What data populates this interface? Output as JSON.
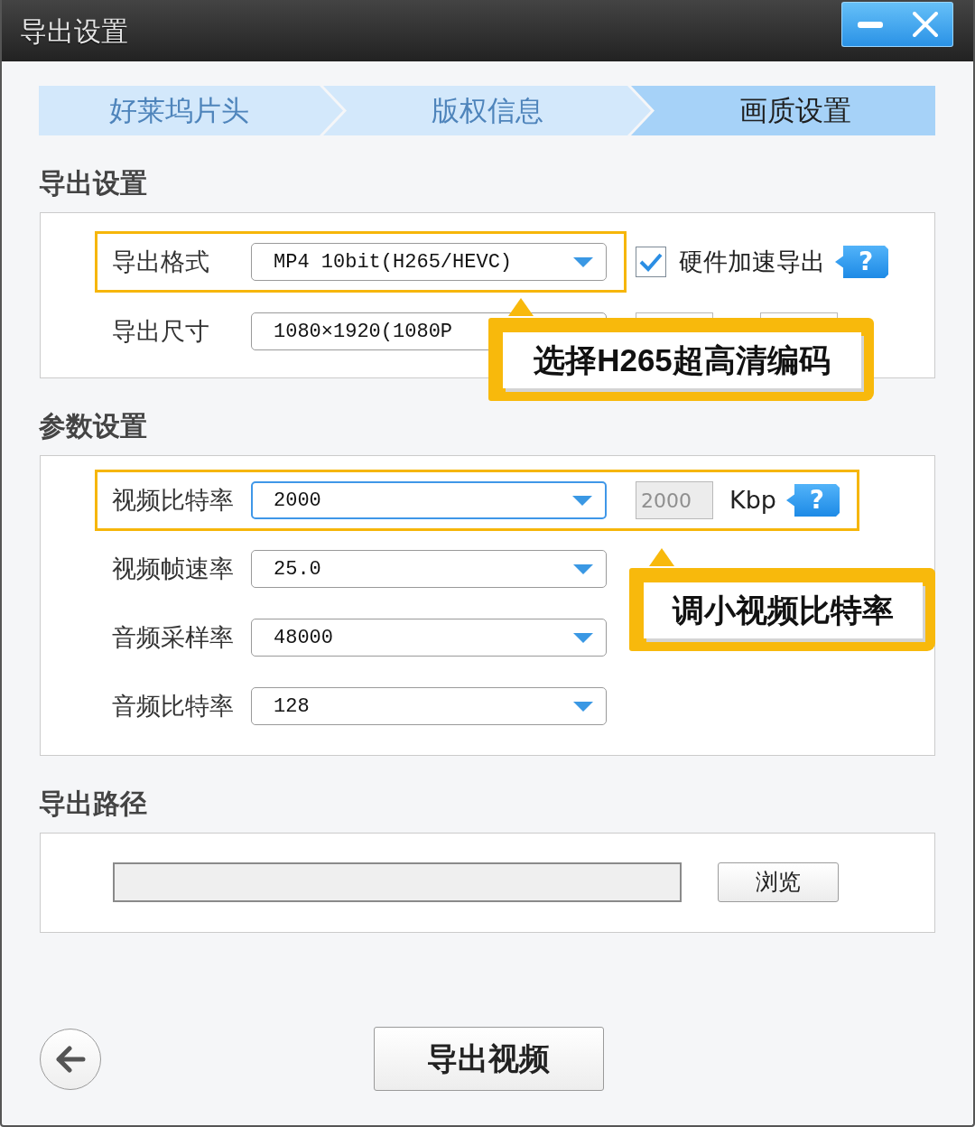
{
  "window": {
    "title": "导出设置"
  },
  "window_controls": [
    {
      "kind": "minimize"
    },
    {
      "kind": "close"
    }
  ],
  "steps": [
    {
      "label": "好莱坞片头",
      "selected": false
    },
    {
      "label": "版权信息",
      "selected": false
    },
    {
      "label": "画质设置",
      "selected": true
    }
  ],
  "sections": [
    {
      "kind": "form",
      "heading": "导出设置",
      "rows": [
        {
          "items": [
            {
              "kind": "label",
              "text": "导出格式",
              "highlighted": true
            },
            {
              "kind": "select",
              "value": "MP4 10bit(H265/HEVC)",
              "focused": false,
              "highlighted": true
            },
            {
              "kind": "checkbox",
              "label": "硬件加速导出",
              "checked": true,
              "highlighted": false
            },
            {
              "kind": "help",
              "text": "?",
              "highlighted": false
            }
          ]
        },
        {
          "items": [
            {
              "kind": "label",
              "text": "导出尺寸",
              "highlighted": false
            },
            {
              "kind": "select",
              "value": "1080×1920(1080P",
              "focused": false,
              "highlighted": false
            },
            {
              "kind": "blank_field",
              "highlighted": false
            },
            {
              "kind": "blank_field",
              "highlighted": false
            }
          ]
        }
      ],
      "callout": {
        "text": "选择H265超高清编码"
      }
    },
    {
      "kind": "form",
      "heading": "参数设置",
      "rows": [
        {
          "items": [
            {
              "kind": "label",
              "text": "视频比特率",
              "highlighted": true
            },
            {
              "kind": "select",
              "value": "2000",
              "focused": true,
              "highlighted": true
            },
            {
              "kind": "input",
              "value": "2000",
              "disabled": true,
              "highlighted": true
            },
            {
              "kind": "unit",
              "text": "Kbp",
              "highlighted": true
            },
            {
              "kind": "help",
              "text": "?",
              "highlighted": true
            }
          ]
        },
        {
          "items": [
            {
              "kind": "label",
              "text": "视频帧速率",
              "highlighted": false
            },
            {
              "kind": "select",
              "value": "25.0",
              "focused": false,
              "highlighted": false
            }
          ]
        },
        {
          "items": [
            {
              "kind": "label",
              "text": "音频采样率",
              "highlighted": false
            },
            {
              "kind": "select",
              "value": "48000",
              "focused": false,
              "highlighted": false
            }
          ]
        },
        {
          "items": [
            {
              "kind": "label",
              "text": "音频比特率",
              "highlighted": false
            },
            {
              "kind": "select",
              "value": "128",
              "focused": false,
              "highlighted": false
            }
          ]
        }
      ],
      "callout": {
        "text": "调小视频比特率"
      }
    },
    {
      "kind": "path",
      "heading": "导出路径",
      "path_field": {
        "disabled": true
      },
      "button": "浏览"
    }
  ],
  "footer": {
    "export_button": "导出视频"
  }
}
